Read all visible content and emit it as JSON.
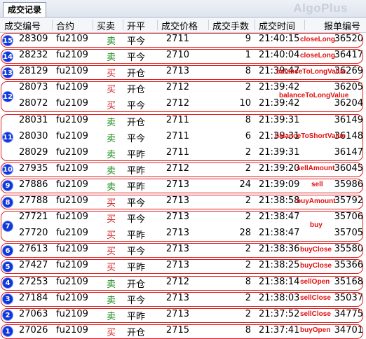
{
  "window": {
    "tab_label": "成交记录",
    "brand": "AlgoPlus"
  },
  "columns": [
    "成交编号",
    "合约",
    "买卖",
    "开平",
    "成交价格",
    "成交手数",
    "成交时间",
    "报单编号"
  ],
  "rows": [
    {
      "id": "28309",
      "contract": "fu2109",
      "side": "卖",
      "offset": "平今",
      "price": "2711",
      "qty": "9",
      "time": "21:40:15",
      "order": "36520"
    },
    {
      "id": "28232",
      "contract": "fu2109",
      "side": "卖",
      "offset": "平今",
      "price": "2710",
      "qty": "1",
      "time": "21:40:04",
      "order": "36417"
    },
    {
      "id": "28129",
      "contract": "fu2109",
      "side": "买",
      "offset": "开仓",
      "price": "2713",
      "qty": "8",
      "time": "21:39:47",
      "order": "36269"
    },
    {
      "id": "28073",
      "contract": "fu2109",
      "side": "买",
      "offset": "开仓",
      "price": "2712",
      "qty": "2",
      "time": "21:39:42",
      "order": "36205"
    },
    {
      "id": "28072",
      "contract": "fu2109",
      "side": "买",
      "offset": "平今",
      "price": "2712",
      "qty": "10",
      "time": "21:39:42",
      "order": "36204"
    },
    {
      "id": "28031",
      "contract": "fu2109",
      "side": "卖",
      "offset": "开仓",
      "price": "2711",
      "qty": "8",
      "time": "21:39:31",
      "order": "36149"
    },
    {
      "id": "28030",
      "contract": "fu2109",
      "side": "卖",
      "offset": "平今",
      "price": "2711",
      "qty": "6",
      "time": "21:39:31",
      "order": "36148"
    },
    {
      "id": "28029",
      "contract": "fu2109",
      "side": "卖",
      "offset": "平昨",
      "price": "2711",
      "qty": "2",
      "time": "21:39:31",
      "order": "36147"
    },
    {
      "id": "27935",
      "contract": "fu2109",
      "side": "卖",
      "offset": "平昨",
      "price": "2712",
      "qty": "2",
      "time": "21:39:20",
      "order": "36045"
    },
    {
      "id": "27886",
      "contract": "fu2109",
      "side": "卖",
      "offset": "平昨",
      "price": "2713",
      "qty": "24",
      "time": "21:39:09",
      "order": "35986"
    },
    {
      "id": "27788",
      "contract": "fu2109",
      "side": "买",
      "offset": "平今",
      "price": "2713",
      "qty": "2",
      "time": "21:38:58",
      "order": "35792"
    },
    {
      "id": "27721",
      "contract": "fu2109",
      "side": "买",
      "offset": "平今",
      "price": "2713",
      "qty": "2",
      "time": "21:38:47",
      "order": "35706"
    },
    {
      "id": "27720",
      "contract": "fu2109",
      "side": "买",
      "offset": "平昨",
      "price": "2713",
      "qty": "28",
      "time": "21:38:47",
      "order": "35705"
    },
    {
      "id": "27613",
      "contract": "fu2109",
      "side": "买",
      "offset": "平今",
      "price": "2713",
      "qty": "2",
      "time": "21:38:36",
      "order": "35580"
    },
    {
      "id": "27427",
      "contract": "fu2109",
      "side": "买",
      "offset": "平昨",
      "price": "2713",
      "qty": "2",
      "time": "21:38:25",
      "order": "35366"
    },
    {
      "id": "27253",
      "contract": "fu2109",
      "side": "卖",
      "offset": "开仓",
      "price": "2712",
      "qty": "8",
      "time": "21:38:14",
      "order": "35168"
    },
    {
      "id": "27184",
      "contract": "fu2109",
      "side": "卖",
      "offset": "平今",
      "price": "2713",
      "qty": "2",
      "time": "21:38:03",
      "order": "35037"
    },
    {
      "id": "27063",
      "contract": "fu2109",
      "side": "卖",
      "offset": "平昨",
      "price": "2713",
      "qty": "2",
      "time": "21:37:52",
      "order": "34775"
    },
    {
      "id": "27026",
      "contract": "fu2109",
      "side": "买",
      "offset": "开仓",
      "price": "2715",
      "qty": "8",
      "time": "21:37:41",
      "order": "34701"
    }
  ],
  "groups": [
    {
      "badge": "15",
      "label": "closeLong",
      "first": 0,
      "count": 1
    },
    {
      "badge": "14",
      "label": "closeLong",
      "first": 1,
      "count": 1
    },
    {
      "badge": "13",
      "label": "balanceToLongValue",
      "first": 2,
      "count": 1
    },
    {
      "badge": "12",
      "label": "balanceToLongValue",
      "first": 3,
      "count": 2
    },
    {
      "badge": "11",
      "label": "balanceToShortValue",
      "first": 5,
      "count": 3
    },
    {
      "badge": "10",
      "label": "sellAmount",
      "first": 8,
      "count": 1
    },
    {
      "badge": "9",
      "label": "sell",
      "first": 9,
      "count": 1
    },
    {
      "badge": "8",
      "label": "buyAmount",
      "first": 10,
      "count": 1
    },
    {
      "badge": "7",
      "label": "buy",
      "first": 11,
      "count": 2
    },
    {
      "badge": "6",
      "label": "buyClose",
      "first": 13,
      "count": 1
    },
    {
      "badge": "5",
      "label": "buyClose",
      "first": 14,
      "count": 1
    },
    {
      "badge": "4",
      "label": "sellOpen",
      "first": 15,
      "count": 1
    },
    {
      "badge": "3",
      "label": "sellClose",
      "first": 16,
      "count": 1
    },
    {
      "badge": "2",
      "label": "sellClose",
      "first": 17,
      "count": 1
    },
    {
      "badge": "1",
      "label": "buyOpen",
      "first": 18,
      "count": 1
    }
  ],
  "colors": {
    "sell": "#1e8a1e",
    "buy": "#d02020",
    "annotation": "#e01010",
    "badge": "#1038d8"
  }
}
